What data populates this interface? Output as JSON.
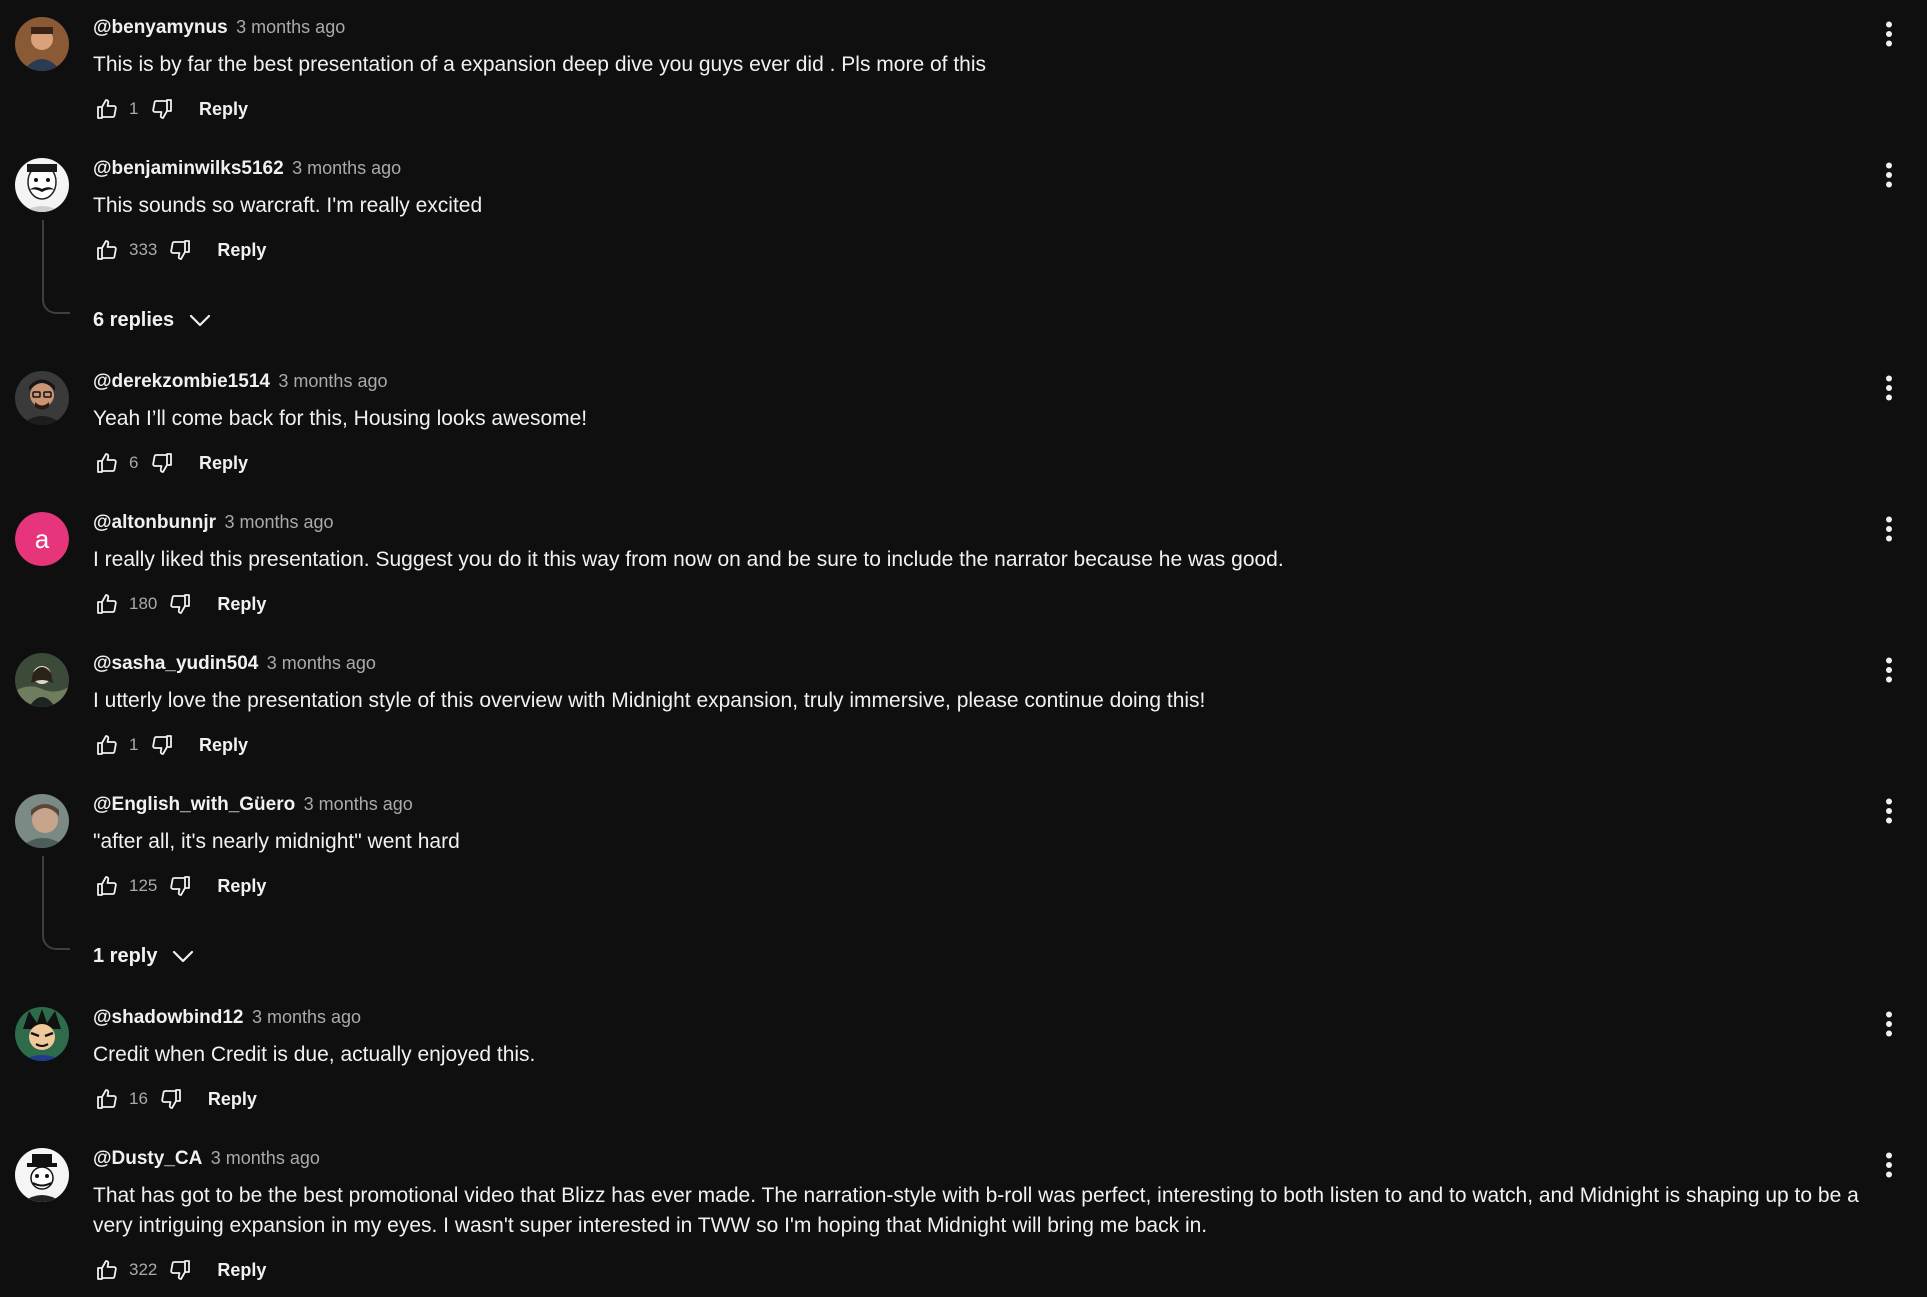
{
  "icons": {
    "like": "thumb-up-icon",
    "dislike": "thumb-down-icon",
    "menu": "more-vert-icon",
    "expand": "chevron-down-icon"
  },
  "colors": {
    "background": "#0f0f0f",
    "text": "#f1f1f1",
    "secondary_text": "#aaaaaa",
    "letter_avatar": "#e6357a"
  },
  "comments": [
    {
      "author": "@benyamynus",
      "time": "3 months ago",
      "text": "This is by far the best presentation of a expansion deep dive you guys ever did . Pls more of this",
      "likes": "1",
      "reply_label": "Reply"
    },
    {
      "author": "@benjaminwilks5162",
      "time": "3 months ago",
      "text": "This sounds so warcraft. I'm really excited",
      "likes": "333",
      "reply_label": "Reply",
      "replies_label": "6 replies"
    },
    {
      "author": "@derekzombie1514",
      "time": "3 months ago",
      "text": "Yeah I’ll come back for this, Housing looks awesome!",
      "likes": "6",
      "reply_label": "Reply"
    },
    {
      "author": "@altonbunnjr",
      "time": "3 months ago",
      "text": "I really liked this presentation. Suggest you do it this way from now on and be sure to include the narrator because he was good.",
      "likes": "180",
      "reply_label": "Reply",
      "avatar_letter": "a"
    },
    {
      "author": "@sasha_yudin504",
      "time": "3 months ago",
      "text": "I utterly love the presentation style of this overview with Midnight expansion, truly immersive, please continue doing this!",
      "likes": "1",
      "reply_label": "Reply"
    },
    {
      "author": "@English_with_Güero",
      "time": "3 months ago",
      "text": "\"after all, it's nearly midnight\" went hard",
      "likes": "125",
      "reply_label": "Reply",
      "replies_label": "1 reply"
    },
    {
      "author": "@shadowbind12",
      "time": "3 months ago",
      "text": "Credit when Credit is due, actually enjoyed this.",
      "likes": "16",
      "reply_label": "Reply"
    },
    {
      "author": "@Dusty_CA",
      "time": "3 months ago",
      "text": "That has got to be the best promotional video that Blizz has ever made. The narration-style with b-roll was perfect, interesting to both listen to and to watch, and Midnight is shaping up to be a very intriguing expansion in my eyes. I wasn't super interested in TWW so I'm hoping that Midnight will bring me back in.",
      "likes": "322",
      "reply_label": "Reply"
    }
  ]
}
